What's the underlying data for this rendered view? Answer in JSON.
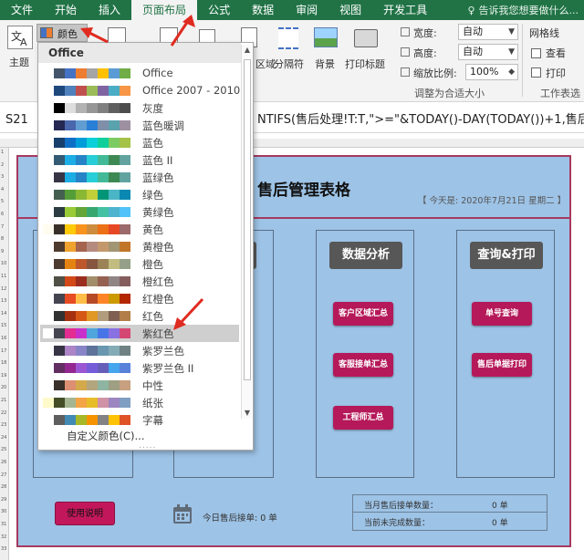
{
  "tabs": [
    "文件",
    "开始",
    "插入",
    "页面布局",
    "公式",
    "数据",
    "审阅",
    "视图",
    "开发工具"
  ],
  "active_tab": "页面布局",
  "tell_me": "告诉我您想要做什么...",
  "ribbon": {
    "theme_label": "主题",
    "colors_label": "颜色",
    "area_label": "区域",
    "breaks_label": "分隔符",
    "background_label": "背景",
    "print_titles_label": "打印标题",
    "width_label": "宽度:",
    "width_value": "自动",
    "height_label": "高度:",
    "height_value": "自动",
    "scale_label": "缩放比例:",
    "scale_value": "100%",
    "scale_group": "调整为合适大小",
    "gridlines_label": "网格线",
    "view_label": "查看",
    "print_label": "打印",
    "sheet_options_group": "工作表选"
  },
  "formula_bar": {
    "name_box": "S21",
    "formula": "NTIFS(售后处理!T:T,\">=\"&TODAY()-DAY(TODAY())+1,售后处"
  },
  "dropdown": {
    "header": "Office",
    "schemes": [
      {
        "name": "Office",
        "colors": [
          "#ffffff",
          "#44546a",
          "#4472c4",
          "#ed7d31",
          "#a5a5a5",
          "#ffc000",
          "#5b9bd5",
          "#70ad47"
        ]
      },
      {
        "name": "Office 2007 - 2010",
        "colors": [
          "#ffffff",
          "#1f497d",
          "#4f81bd",
          "#c0504d",
          "#9bbb59",
          "#8064a2",
          "#4bacc6",
          "#f79646"
        ]
      },
      {
        "name": "灰度",
        "colors": [
          "#ffffff",
          "#000000",
          "#dddddd",
          "#b2b2b2",
          "#969696",
          "#808080",
          "#5f5f5f",
          "#4d4d4d"
        ]
      },
      {
        "name": "蓝色暖调",
        "colors": [
          "#ffffff",
          "#242852",
          "#4a66ac",
          "#629dd1",
          "#297fd5",
          "#7f8fa9",
          "#5aa2ae",
          "#9d90a0"
        ]
      },
      {
        "name": "蓝色",
        "colors": [
          "#ffffff",
          "#17406d",
          "#0f6fc6",
          "#009dd9",
          "#0bd0d9",
          "#10cf9b",
          "#7cca62",
          "#a5c249"
        ]
      },
      {
        "name": "蓝色 II",
        "colors": [
          "#ffffff",
          "#335b74",
          "#1cade4",
          "#2683c6",
          "#27ced7",
          "#42ba97",
          "#3e8853",
          "#62a39f"
        ]
      },
      {
        "name": "蓝绿色",
        "colors": [
          "#ffffff",
          "#373545",
          "#1cade4",
          "#2683c6",
          "#27ced7",
          "#42ba97",
          "#3e8853",
          "#62a39f"
        ]
      },
      {
        "name": "绿色",
        "colors": [
          "#ffffff",
          "#455f51",
          "#549e39",
          "#8ab833",
          "#c0cf3a",
          "#029676",
          "#4ab5c4",
          "#0989b1"
        ]
      },
      {
        "name": "黄绿色",
        "colors": [
          "#ffffff",
          "#2c3c43",
          "#99cb38",
          "#63a537",
          "#37a76f",
          "#44c1a3",
          "#4eb3cf",
          "#51c3f9"
        ]
      },
      {
        "name": "黄色",
        "colors": [
          "#fffcf0",
          "#39302a",
          "#ffca08",
          "#f8931d",
          "#ce8d3e",
          "#ec7016",
          "#e64823",
          "#9c6a6a"
        ]
      },
      {
        "name": "黄橙色",
        "colors": [
          "#ffffff",
          "#4e3b30",
          "#f0a22e",
          "#a5644e",
          "#b58b80",
          "#c3986d",
          "#a19574",
          "#c17529"
        ]
      },
      {
        "name": "橙色",
        "colors": [
          "#ffffff",
          "#4e3b30",
          "#e48312",
          "#bd582c",
          "#865640",
          "#9b8357",
          "#c2bc80",
          "#94a088"
        ]
      },
      {
        "name": "橙红色",
        "colors": [
          "#ffffff",
          "#505046",
          "#d34817",
          "#9b2d1f",
          "#a28e6a",
          "#956251",
          "#918485",
          "#855d5d"
        ]
      },
      {
        "name": "红橙色",
        "colors": [
          "#ffffff",
          "#454551",
          "#e84c22",
          "#ffbd47",
          "#b64926",
          "#ff8427",
          "#cc9900",
          "#b22600"
        ]
      },
      {
        "name": "红色",
        "colors": [
          "#ffffff",
          "#323232",
          "#a5300f",
          "#d55816",
          "#e19825",
          "#b19c7d",
          "#7f5f52",
          "#b27d49"
        ]
      },
      {
        "name": "紫红色",
        "colors": [
          "#ffffff",
          "#454551",
          "#e32d91",
          "#c830cc",
          "#4ea6dc",
          "#4775e7",
          "#8971e1",
          "#d54773"
        ]
      },
      {
        "name": "紫罗兰色",
        "colors": [
          "#ffffff",
          "#373545",
          "#ad84c6",
          "#8784c7",
          "#5d739a",
          "#6997af",
          "#84acb6",
          "#6f8183"
        ]
      },
      {
        "name": "紫罗兰色 II",
        "colors": [
          "#ffffff",
          "#632e62",
          "#92278f",
          "#9b57d3",
          "#755dd9",
          "#665eb8",
          "#45a5ed",
          "#5982db"
        ]
      },
      {
        "name": "中性",
        "colors": [
          "#ffffff",
          "#39302a",
          "#dc8f72",
          "#d4a94b",
          "#b3a67e",
          "#8eb5a1",
          "#9e9f83",
          "#c7a080"
        ]
      },
      {
        "name": "纸张",
        "colors": [
          "#fefac9",
          "#444d26",
          "#a5b592",
          "#f3a447",
          "#e7bc29",
          "#d092a7",
          "#9c85c0",
          "#809ec2"
        ]
      },
      {
        "name": "字幕",
        "colors": [
          "#ffffff",
          "#5e5e5e",
          "#418ab3",
          "#a6b727",
          "#f69200",
          "#838383",
          "#fec306",
          "#df5327"
        ]
      }
    ],
    "selected_index": 15,
    "custom_label": "自定义颜色(C)...",
    "dots": "....."
  },
  "sheet": {
    "title": "售后管理表格",
    "today_label": "【 今天是: 2020年7月21日 星期二 】",
    "columns": [
      {
        "header": "",
        "buttons": []
      },
      {
        "header": "",
        "buttons": []
      },
      {
        "header": "数据分析",
        "buttons": [
          "客户区域汇总",
          "客服接单汇总",
          "工程师汇总"
        ]
      },
      {
        "header": "查询&打印",
        "buttons": [
          "单号查询",
          "售后单据打印"
        ]
      }
    ],
    "usage_button": "使用说明",
    "today_orders": "今日售后接单: 0 单",
    "stats": [
      {
        "label": "当月售后接单数量：",
        "value": "0 单"
      },
      {
        "label": "当前未完成数量：",
        "value": "0 单"
      }
    ],
    "row_numbers": [
      "1",
      "2",
      "3",
      "4",
      "5",
      "6",
      "7",
      "8",
      "9",
      "10",
      "11",
      "12",
      "13",
      "14",
      "15",
      "16",
      "17",
      "18",
      "19",
      "20",
      "21",
      "22",
      "23",
      "24",
      "25",
      "26",
      "27",
      "28",
      "29",
      "30",
      "31",
      "32",
      "33"
    ]
  },
  "colors": {
    "accent": "#217346",
    "frame": "#a63a5f",
    "panel": "#9dc3e6",
    "button": "#b5195a",
    "arrow": "#e02b20"
  }
}
